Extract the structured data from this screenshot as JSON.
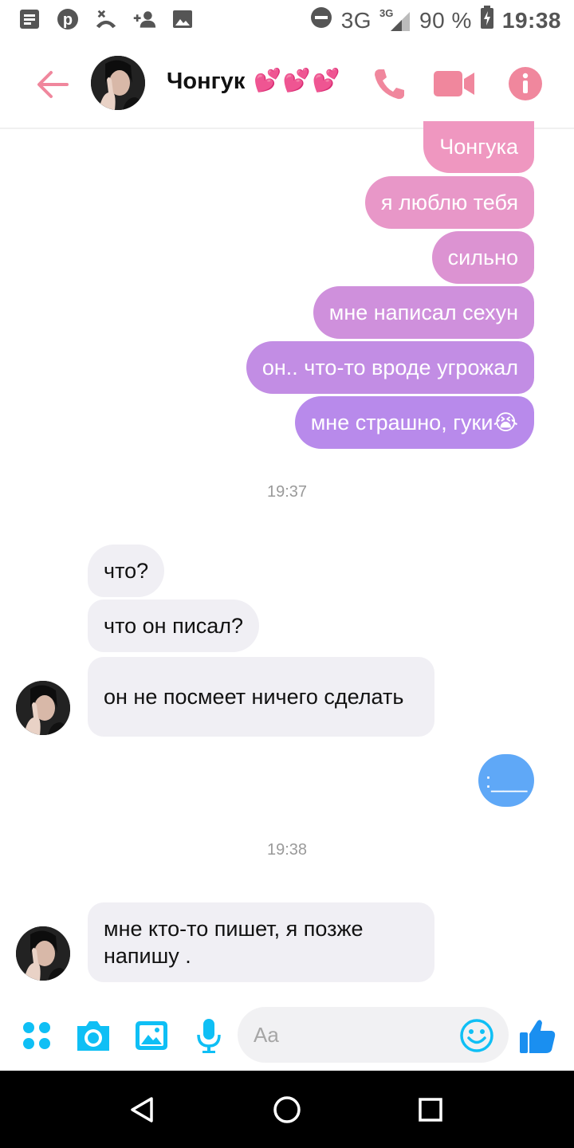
{
  "status_bar": {
    "network": "3G",
    "network_small": "3G",
    "battery": "90 %",
    "time": "19:38"
  },
  "header": {
    "contact_name": "Чонгук",
    "hearts": "💕💕💕"
  },
  "messages": {
    "out": [
      "Чонгука",
      "я люблю тебя",
      "сильно",
      "мне написал сехун",
      "он.. что-то вроде угрожал",
      "мне страшно, гуки😭"
    ],
    "timestamp1": "19:37",
    "in": [
      "что?",
      "что он писал?",
      "он не посмеет ничего сделать"
    ],
    "out_blue": ":___",
    "timestamp2": "19:38",
    "in_last": "мне кто-то пишет, я позже напишу ."
  },
  "composer": {
    "placeholder": "Aa"
  },
  "colors": {
    "accent_pink": "#f0879d",
    "bubble_gradient_top": "#ef95b8",
    "bubble_gradient_bottom": "#b889ea",
    "blue_bubble": "#5fa8f7",
    "composer_icon": "#0fbff5",
    "thumb": "#1a8ff0"
  }
}
